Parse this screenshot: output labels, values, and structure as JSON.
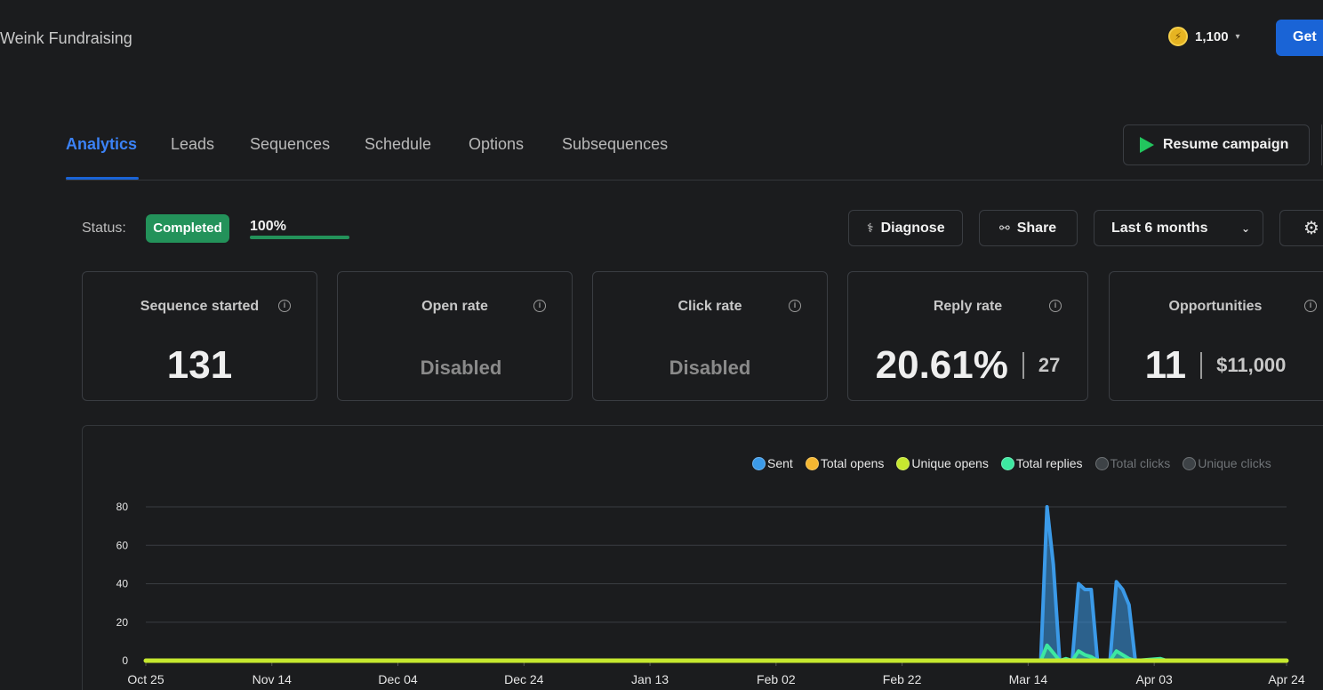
{
  "header": {
    "breadcrumb": "Weink Fundraising",
    "credits": "1,100",
    "get_button": "Get"
  },
  "tabs": [
    {
      "label": "Analytics",
      "active": true
    },
    {
      "label": "Leads"
    },
    {
      "label": "Sequences"
    },
    {
      "label": "Schedule"
    },
    {
      "label": "Options"
    },
    {
      "label": "Subsequences"
    }
  ],
  "resume_button": "Resume campaign",
  "status": {
    "label": "Status:",
    "badge": "Completed",
    "progress_text": "100%",
    "progress_fraction": 1.0
  },
  "controls": {
    "diagnose": "Diagnose",
    "share": "Share",
    "range": "Last 6 months"
  },
  "cards": {
    "sequence_started": {
      "title": "Sequence started",
      "value": "131"
    },
    "open_rate": {
      "title": "Open rate",
      "value": "Disabled"
    },
    "click_rate": {
      "title": "Click rate",
      "value": "Disabled"
    },
    "reply_rate": {
      "title": "Reply rate",
      "value": "20.61%",
      "count": "27"
    },
    "opportunities": {
      "title": "Opportunities",
      "value": "11",
      "amount": "$11,000"
    }
  },
  "colors": {
    "accent": "#1a64d6",
    "success": "#23925a",
    "sent": "#3b9ae8",
    "total_opens": "#f5b731",
    "unique_opens": "#c6e82f",
    "total_replies": "#3de8a0",
    "disabled_series": "#3d4246"
  },
  "chart_data": {
    "type": "area",
    "ylim": [
      0,
      80
    ],
    "yticks": [
      "0",
      "20",
      "40",
      "60",
      "80"
    ],
    "xticks": [
      "Oct 25",
      "Nov 14",
      "Dec 04",
      "Dec 24",
      "Jan 13",
      "Feb 02",
      "Feb 22",
      "Mar 14",
      "Apr 03",
      "Apr 24"
    ],
    "legend": [
      {
        "name": "Sent",
        "color": "#3b9ae8",
        "enabled": true
      },
      {
        "name": "Total opens",
        "color": "#f5b731",
        "enabled": true
      },
      {
        "name": "Unique opens",
        "color": "#c6e82f",
        "enabled": true
      },
      {
        "name": "Total replies",
        "color": "#3de8a0",
        "enabled": true
      },
      {
        "name": "Total clicks",
        "color": "#3d4246",
        "enabled": false
      },
      {
        "name": "Unique clicks",
        "color": "#3d4246",
        "enabled": false
      }
    ],
    "series": [
      {
        "name": "Sent",
        "points": [
          [
            "Oct 25",
            0
          ],
          [
            "Mar 16",
            0
          ],
          [
            "Mar 17",
            80
          ],
          [
            "Mar 18",
            50
          ],
          [
            "Mar 19",
            0
          ],
          [
            "Mar 20",
            0
          ],
          [
            "Mar 21",
            0
          ],
          [
            "Mar 22",
            40
          ],
          [
            "Mar 23",
            37
          ],
          [
            "Mar 24",
            37
          ],
          [
            "Mar 25",
            0
          ],
          [
            "Mar 26",
            0
          ],
          [
            "Mar 27",
            0
          ],
          [
            "Mar 28",
            41
          ],
          [
            "Mar 29",
            37
          ],
          [
            "Mar 30",
            29
          ],
          [
            "Mar 31",
            0
          ],
          [
            "Apr 24",
            0
          ]
        ]
      },
      {
        "name": "Total replies",
        "points": [
          [
            "Oct 25",
            0
          ],
          [
            "Mar 16",
            0
          ],
          [
            "Mar 17",
            8
          ],
          [
            "Mar 18",
            4
          ],
          [
            "Mar 19",
            0
          ],
          [
            "Mar 20",
            1
          ],
          [
            "Mar 21",
            0
          ],
          [
            "Mar 22",
            5
          ],
          [
            "Mar 23",
            3
          ],
          [
            "Mar 24",
            2
          ],
          [
            "Mar 25",
            0
          ],
          [
            "Mar 26",
            0
          ],
          [
            "Mar 27",
            0
          ],
          [
            "Mar 28",
            5
          ],
          [
            "Mar 29",
            3
          ],
          [
            "Mar 30",
            1
          ],
          [
            "Mar 31",
            0
          ],
          [
            "Apr 04",
            1
          ],
          [
            "Apr 05",
            0
          ],
          [
            "Apr 24",
            0
          ]
        ]
      },
      {
        "name": "Unique opens",
        "points": [
          [
            "Oct 25",
            0
          ],
          [
            "Apr 24",
            0
          ]
        ]
      }
    ]
  }
}
